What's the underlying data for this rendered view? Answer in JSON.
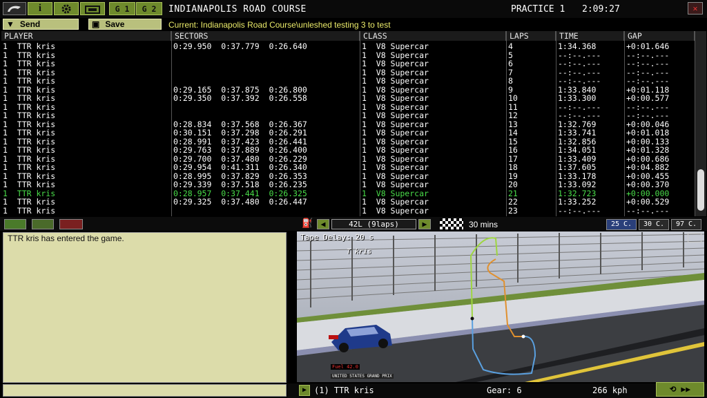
{
  "topbar": {
    "group_1": "G 1",
    "group_2": "G 2",
    "track_name": "INDIANAPOLIS ROAD COURSE",
    "session": "PRACTICE 1",
    "clock": "2:09:27",
    "icons": [
      "logo-icon",
      "info-icon",
      "gear-icon",
      "garage-icon",
      "close-icon"
    ]
  },
  "actions": {
    "send_label": "Send",
    "save_label": "Save",
    "current_line": "Current: Indianapolis Road Course\\unleshed testing 3 to test"
  },
  "table": {
    "headers": [
      "PLAYER",
      "SECTORS",
      "CLASS",
      "LAPS",
      "TIME",
      "GAP"
    ],
    "rows": [
      [
        "1  TTR kris",
        "0:29.950  0:37.779  0:26.640",
        "1  V8 Supercar",
        "4",
        "1:34.368",
        "+0:01.646"
      ],
      [
        "1  TTR kris",
        "",
        "1  V8 Supercar",
        "5",
        "--:--.---",
        "--:--.---"
      ],
      [
        "1  TTR kris",
        "",
        "1  V8 Supercar",
        "6",
        "--:--.---",
        "--:--.---"
      ],
      [
        "1  TTR kris",
        "",
        "1  V8 Supercar",
        "7",
        "--:--.---",
        "--:--.---"
      ],
      [
        "1  TTR kris",
        "",
        "1  V8 Supercar",
        "8",
        "--:--.---",
        "--:--.---"
      ],
      [
        "1  TTR kris",
        "0:29.165  0:37.875  0:26.800",
        "1  V8 Supercar",
        "9",
        "1:33.840",
        "+0:01.118"
      ],
      [
        "1  TTR kris",
        "0:29.350  0:37.392  0:26.558",
        "1  V8 Supercar",
        "10",
        "1:33.300",
        "+0:00.577"
      ],
      [
        "1  TTR kris",
        "",
        "1  V8 Supercar",
        "11",
        "--:--.---",
        "--:--.---"
      ],
      [
        "1  TTR kris",
        "",
        "1  V8 Supercar",
        "12",
        "--:--.---",
        "--:--.---"
      ],
      [
        "1  TTR kris",
        "0:28.834  0:37.568  0:26.367",
        "1  V8 Supercar",
        "13",
        "1:32.769",
        "+0:00.046"
      ],
      [
        "1  TTR kris",
        "0:30.151  0:37.298  0:26.291",
        "1  V8 Supercar",
        "14",
        "1:33.741",
        "+0:01.018"
      ],
      [
        "1  TTR kris",
        "0:28.991  0:37.423  0:26.441",
        "1  V8 Supercar",
        "15",
        "1:32.856",
        "+0:00.133"
      ],
      [
        "1  TTR kris",
        "0:29.763  0:37.889  0:26.400",
        "1  V8 Supercar",
        "16",
        "1:34.051",
        "+0:01.328"
      ],
      [
        "1  TTR kris",
        "0:29.700  0:37.480  0:26.229",
        "1  V8 Supercar",
        "17",
        "1:33.409",
        "+0:00.686"
      ],
      [
        "1  TTR kris",
        "0:29.954  0:41.311  0:26.340",
        "1  V8 Supercar",
        "18",
        "1:37.605",
        "+0:04.882"
      ],
      [
        "1  TTR kris",
        "0:28.995  0:37.829  0:26.353",
        "1  V8 Supercar",
        "19",
        "1:33.178",
        "+0:00.455"
      ],
      [
        "1  TTR kris",
        "0:29.339  0:37.518  0:26.235",
        "1  V8 Supercar",
        "20",
        "1:33.092",
        "+0:00.370"
      ],
      [
        "1  TTR kris",
        "0:28.957  0:37.441  0:26.325",
        "1  V8 Supercar",
        "21",
        "1:32.723",
        "+0:00.000"
      ],
      [
        "1  TTR kris",
        "0:29.325  0:37.480  0:26.447",
        "1  V8 Supercar",
        "22",
        "1:33.252",
        "+0:00.529"
      ],
      [
        "1  TTR kris",
        "",
        "1  V8 Supercar",
        "23",
        "--:--.---",
        "--:--.---"
      ]
    ],
    "highlight_row": 17,
    "highlight_color": "#4ade4a"
  },
  "controls": {
    "fuel": "42L (9laps)",
    "race_time": "30 mins",
    "temp_ambient": "25 C.",
    "temp_track": "30 C.",
    "temp_third": "97 C."
  },
  "chat": {
    "message": "TTR kris has entered the game."
  },
  "view": {
    "tape_delay": "Tape Delay: 20 s",
    "marker_label": "T kris",
    "fuel_overlay": "Fuel 42.0",
    "banner": "UNITED STATES GRAND PRIX"
  },
  "status": {
    "driver": "(1) TTR kris",
    "gear": "Gear: 6",
    "speed": "266 kph"
  },
  "colors": {
    "accent_green": "#6e8a2c",
    "panel_khaki": "#dcdcaa",
    "current_text": "#ecec6a"
  }
}
